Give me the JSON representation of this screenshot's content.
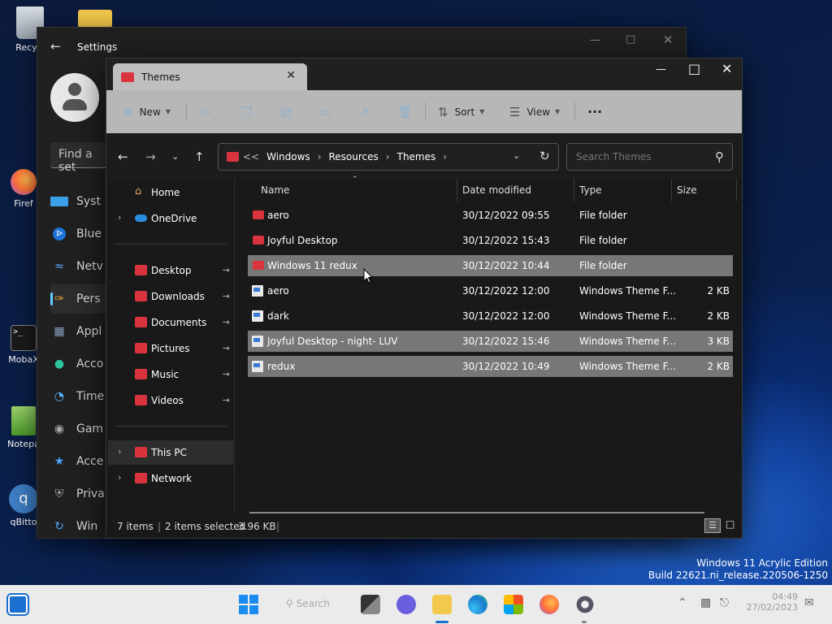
{
  "desktop": {
    "icons": [
      {
        "label": "Recycl"
      },
      {
        "label": "Firef"
      },
      {
        "label": "MobaX"
      },
      {
        "label": "Notepa"
      },
      {
        "label": "qBitto"
      }
    ],
    "watermark": {
      "line1": "Windows 11 Acrylic Edition",
      "line2": "Build 22621.ni_release.220506-1250"
    }
  },
  "settings": {
    "title": "Settings",
    "find_placeholder": "Find a set",
    "nav": [
      {
        "label": "Syst",
        "icon": "monitor-icon"
      },
      {
        "label": "Blue",
        "icon": "bluetooth-icon"
      },
      {
        "label": "Netv",
        "icon": "wifi-icon"
      },
      {
        "label": "Pers",
        "icon": "brush-icon"
      },
      {
        "label": "Appl",
        "icon": "apps-icon"
      },
      {
        "label": "Acco",
        "icon": "person-icon"
      },
      {
        "label": "Time",
        "icon": "clock-icon"
      },
      {
        "label": "Gam",
        "icon": "gamepad-icon"
      },
      {
        "label": "Acce",
        "icon": "accessibility-icon"
      },
      {
        "label": "Priva",
        "icon": "shield-icon"
      },
      {
        "label": "Win",
        "icon": "update-icon"
      }
    ]
  },
  "explorer": {
    "tab_title": "Themes",
    "toolbar": {
      "new": "New",
      "sort": "Sort",
      "view": "View",
      "more": "···"
    },
    "address": {
      "overflow": "<<",
      "crumbs": [
        "Windows",
        "Resources",
        "Themes"
      ]
    },
    "search_placeholder": "Search Themes",
    "nav": {
      "home": "Home",
      "onedrive": "OneDrive",
      "quick": [
        {
          "label": "Desktop"
        },
        {
          "label": "Downloads"
        },
        {
          "label": "Documents"
        },
        {
          "label": "Pictures"
        },
        {
          "label": "Music"
        },
        {
          "label": "Videos"
        }
      ],
      "this_pc": "This PC",
      "network": "Network"
    },
    "columns": {
      "name": "Name",
      "date": "Date modified",
      "type": "Type",
      "size": "Size"
    },
    "files": [
      {
        "name": "aero",
        "date": "30/12/2022 09:55",
        "type": "File folder",
        "size": "",
        "kind": "folder",
        "selected": false
      },
      {
        "name": "Joyful Desktop",
        "date": "30/12/2022 15:43",
        "type": "File folder",
        "size": "",
        "kind": "folder",
        "selected": false
      },
      {
        "name": "Windows 11 redux",
        "date": "30/12/2022 10:44",
        "type": "File folder",
        "size": "",
        "kind": "folder",
        "selected": true
      },
      {
        "name": "aero",
        "date": "30/12/2022 12:00",
        "type": "Windows Theme F...",
        "size": "2 KB",
        "kind": "theme",
        "selected": false
      },
      {
        "name": "dark",
        "date": "30/12/2022 12:00",
        "type": "Windows Theme F...",
        "size": "2 KB",
        "kind": "theme",
        "selected": false
      },
      {
        "name": "Joyful Desktop - night- LUV",
        "date": "30/12/2022 15:46",
        "type": "Windows Theme F...",
        "size": "3 KB",
        "kind": "theme",
        "selected": true
      },
      {
        "name": "redux",
        "date": "30/12/2022 10:49",
        "type": "Windows Theme F...",
        "size": "2 KB",
        "kind": "theme",
        "selected": true
      }
    ],
    "status": {
      "count": "7 items",
      "selected": "2 items selected",
      "size": "3.96 KB"
    }
  },
  "taskbar": {
    "search": "Search",
    "time": "04:49",
    "date": "27/02/2023"
  },
  "colors": {
    "accent": "#60cdff",
    "folder": "#d9343e",
    "toolbar": "#b7b7b7"
  }
}
